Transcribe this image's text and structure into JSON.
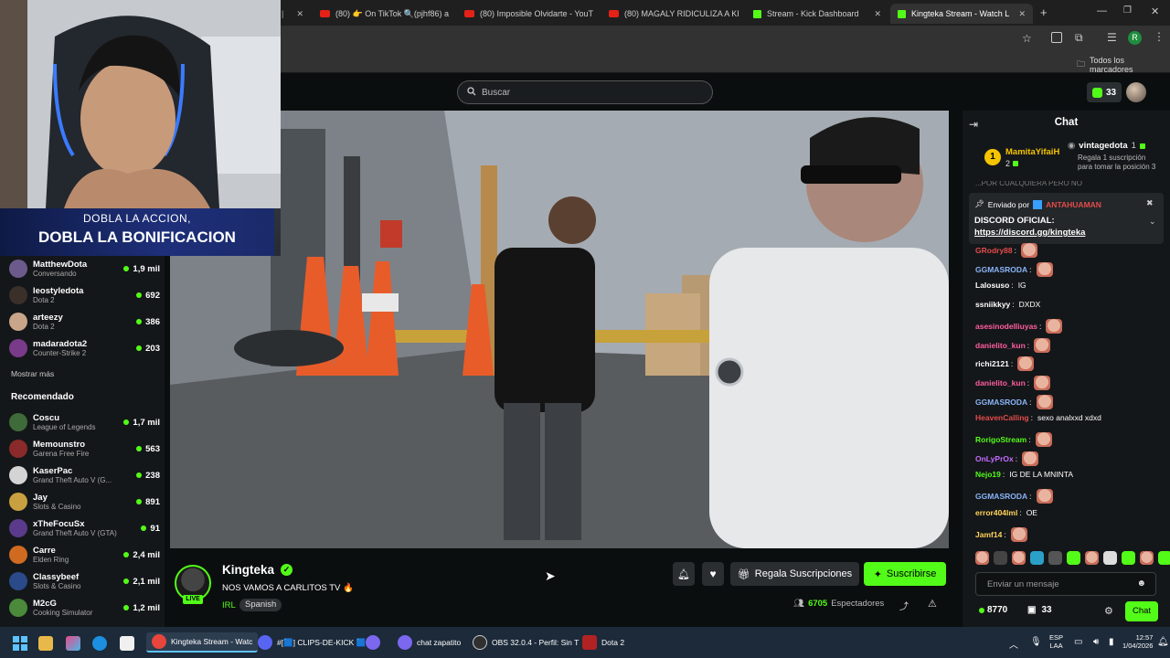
{
  "browser": {
    "tabs": [
      {
        "label": "(80) 👉 On TikTok 🔍(pjhf86) a",
        "type": "youtube"
      },
      {
        "label": "(80) Imposible Olvidarte - YouT",
        "type": "youtube"
      },
      {
        "label": "(80) MAGALY RIDICULIZA A KI",
        "type": "youtube"
      },
      {
        "label": "Stream - Kick Dashboard",
        "type": "kick"
      },
      {
        "label": "Kingteka Stream - Watch L",
        "type": "kick"
      }
    ],
    "bookmarks_label": "Todos los marcadores"
  },
  "header": {
    "search_placeholder": "Buscar",
    "kicks_count": "33"
  },
  "webcam": {
    "banner_line1": "DOBLA LA ACCION,",
    "banner_line2": "DOBLA LA BONIFICACION"
  },
  "sidebar": {
    "following": [
      {
        "name": "MatthewDota",
        "category": "Conversando",
        "viewers": "1,9 mil",
        "color": "#6d5a8c"
      },
      {
        "name": "leostyledota",
        "category": "Dota 2",
        "viewers": "692",
        "color": "#3b2f2a"
      },
      {
        "name": "arteezy",
        "category": "Dota 2",
        "viewers": "386",
        "color": "#c9a68a"
      },
      {
        "name": "madaradota2",
        "category": "Counter-Strike 2",
        "viewers": "203",
        "color": "#7a3a8a"
      }
    ],
    "show_more": "Mostrar más",
    "recommended_heading": "Recomendado",
    "recommended": [
      {
        "name": "Coscu",
        "category": "League of Legends",
        "viewers": "1,7 mil",
        "color": "#3f6b3a"
      },
      {
        "name": "Memounstro",
        "category": "Garena Free Fire",
        "viewers": "563",
        "color": "#8a2a2a"
      },
      {
        "name": "KaserPac",
        "category": "Grand Theft Auto V (G...",
        "viewers": "238",
        "color": "#d4d4d4"
      },
      {
        "name": "Jay",
        "category": "Slots & Casino",
        "viewers": "891",
        "color": "#c9a040"
      },
      {
        "name": "xTheFocuSx",
        "category": "Grand Theft Auto V (GTA)",
        "viewers": "91",
        "color": "#5a3a8a"
      },
      {
        "name": "Carre",
        "category": "Elden Ring",
        "viewers": "2,4 mil",
        "color": "#d06a20"
      },
      {
        "name": "Classybeef",
        "category": "Slots & Casino",
        "viewers": "2,1 mil",
        "color": "#2a4a8a"
      },
      {
        "name": "M2cG",
        "category": "Cooking Simulator",
        "viewers": "1,2 mil",
        "color": "#4a8a3a"
      }
    ]
  },
  "stream": {
    "streamer": "Kingteka",
    "live_label": "LIVE",
    "title": "NOS VAMOS A CARLITOS TV 🔥",
    "category": "IRL",
    "language": "Spanish",
    "gift_label": "Regala Suscripciones",
    "subscribe_label": "Suscribirse",
    "viewer_count": "6705",
    "viewer_suffix": "Espectadores"
  },
  "chat": {
    "title": "Chat",
    "leader1": {
      "rank": "1",
      "name": "MamitaYifaiH",
      "count": "2"
    },
    "leader2": {
      "name": "vintagedota",
      "count": "1",
      "note": "Regala 1 suscripción para tomar la posición 3"
    },
    "cut_message": "...POR CUALQUIERA PERO NO",
    "pinned_by_label": "Enviado por",
    "pinned_by_user": "ANTAHUAMAN",
    "pinned_title": "DISCORD OFICIAL:",
    "pinned_link": "https://discord.gg/kingteka",
    "messages": [
      {
        "user": "GRodry88",
        "text": "",
        "emote": true,
        "color": "#e34b4b"
      },
      {
        "user": "GGMASRODA",
        "text": "",
        "emote": true,
        "color": "#8ab4f8"
      },
      {
        "user": "Lalosuso",
        "text": "IG",
        "emote": false,
        "color": "#ffffff"
      },
      {
        "user": "ssniikkyy",
        "text": "DXDX",
        "emote": false,
        "color": "#ffffff"
      },
      {
        "user": "asesinodelliuyas",
        "text": "",
        "emote": true,
        "color": "#ff5da2"
      },
      {
        "user": "danielito_kun",
        "text": "",
        "emote": true,
        "color": "#ff5da2"
      },
      {
        "user": "richi2121",
        "text": "",
        "emote": true,
        "color": "#ffffff"
      },
      {
        "user": "danielito_kun",
        "text": "",
        "emote": true,
        "color": "#ff5da2"
      },
      {
        "user": "GGMASRODA",
        "text": "",
        "emote": true,
        "color": "#8ab4f8"
      },
      {
        "user": "HeavenCalling",
        "text": "sexo analxxd xdxd",
        "emote": false,
        "color": "#e34b4b"
      },
      {
        "user": "RorigoStream",
        "text": "",
        "emote": true,
        "color": "#53fc18"
      },
      {
        "user": "OnLyPrOx",
        "text": "",
        "emote": true,
        "color": "#c36bff"
      },
      {
        "user": "Nejo19",
        "text": "IG DE LA MNINTA",
        "emote": false,
        "color": "#53fc18"
      },
      {
        "user": "GGMASRODA",
        "text": "",
        "emote": true,
        "color": "#8ab4f8"
      },
      {
        "user": "error404lml",
        "text": "OE",
        "emote": false,
        "color": "#ffd25a"
      },
      {
        "user": "Jamf14",
        "text": "",
        "emote": true,
        "color": "#ffd25a"
      }
    ],
    "input_placeholder": "Enviar un mensaje",
    "kicks_balance": "8770",
    "sub_count": "33",
    "send_label": "Chat"
  },
  "taskbar": {
    "items": [
      {
        "label": "Kingteka Stream - Watc",
        "color": "#e8453c"
      },
      {
        "label": "#[🟦] CLIPS-DE-KICK 🟦 |",
        "color": "#5865f2"
      },
      {
        "label": "",
        "color": "#7b68ee"
      },
      {
        "label": "chat zapatito",
        "color": "#7b68ee"
      },
      {
        "label": "OBS 32.0.4 - Perfil: Sin T",
        "color": "#303030"
      },
      {
        "label": "Dota 2",
        "color": "#b22222"
      }
    ],
    "lang_line1": "ESP",
    "lang_line2": "LAA",
    "time": "12:57",
    "date": "1/04/2026"
  }
}
